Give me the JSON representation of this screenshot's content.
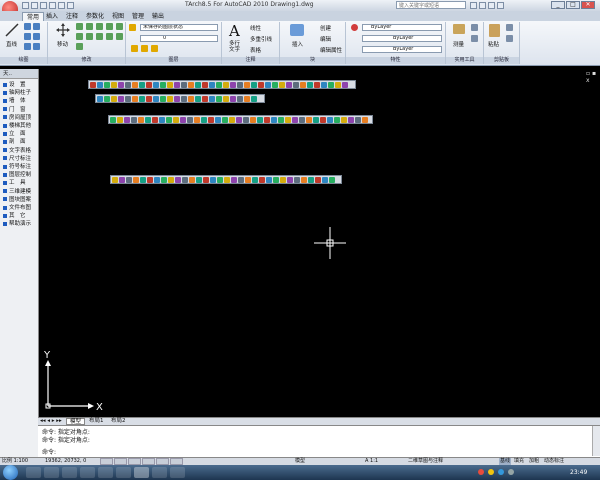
{
  "window": {
    "title": "TArch8.5 For AutoCAD 2010  Drawing1.dwg",
    "search_placeholder": "键入关键字或短语",
    "controls": [
      "_",
      "□",
      "✕"
    ]
  },
  "ribbon_tabs": [
    "常用",
    "插入",
    "注释",
    "参数化",
    "视图",
    "管理",
    "输出"
  ],
  "ribbon_active_tab": "常用",
  "panels": {
    "draw": {
      "title": "绘图",
      "line_label": "直线"
    },
    "modify": {
      "title": "修改",
      "move_label": "移动"
    },
    "layers": {
      "title": "图层",
      "layer_state": "未保存的图层状态",
      "layer_name": "0"
    },
    "annotation": {
      "title": "注释",
      "multiline_text": "多行\n文字",
      "linear": "线性",
      "multileader": "多重引线",
      "table": "表格"
    },
    "block": {
      "title": "块",
      "insert": "插入",
      "create": "创建",
      "edit": "编辑",
      "edit_attributes": "编辑属性"
    },
    "properties": {
      "title": "特性",
      "color": "ByLayer",
      "linetype": "ByLayer",
      "lineweight": "ByLayer"
    },
    "utilities": {
      "title": "实用工具",
      "measure": "测量"
    },
    "clipboard": {
      "title": "剪贴板",
      "paste": "粘贴"
    }
  },
  "palette": {
    "header": "天..",
    "items": [
      "设　置",
      "轴网柱子",
      "墙　体",
      "门　窗",
      "房间屋顶",
      "楼梯其他",
      "立　面",
      "剖　面",
      "文字表格",
      "尺寸标注",
      "符号标注",
      "图层控制",
      "工　具",
      "三维建模",
      "图块图案",
      "文件布图",
      "其　它",
      "帮助演示"
    ]
  },
  "layout_tabs": [
    "模型",
    "布局1",
    "布局2"
  ],
  "command": {
    "history": [
      "命令: 指定对角点:",
      "命令: 指定对角点:"
    ],
    "prompt": "命令:"
  },
  "status": {
    "scale": "比例 1:100",
    "coords": "19362, 20732, 0",
    "model": "模型",
    "annotation_scale": "A 1:1",
    "workspace": "二维草图与注释",
    "toggles": [
      "基线",
      "填充",
      "加粗",
      "动态标注"
    ]
  },
  "taskbar": {
    "time": "23:49"
  },
  "colors": {
    "drawing_bg": "#000000",
    "ribbon_bg": "#eef2f7",
    "accent": "#1d5bbf"
  }
}
